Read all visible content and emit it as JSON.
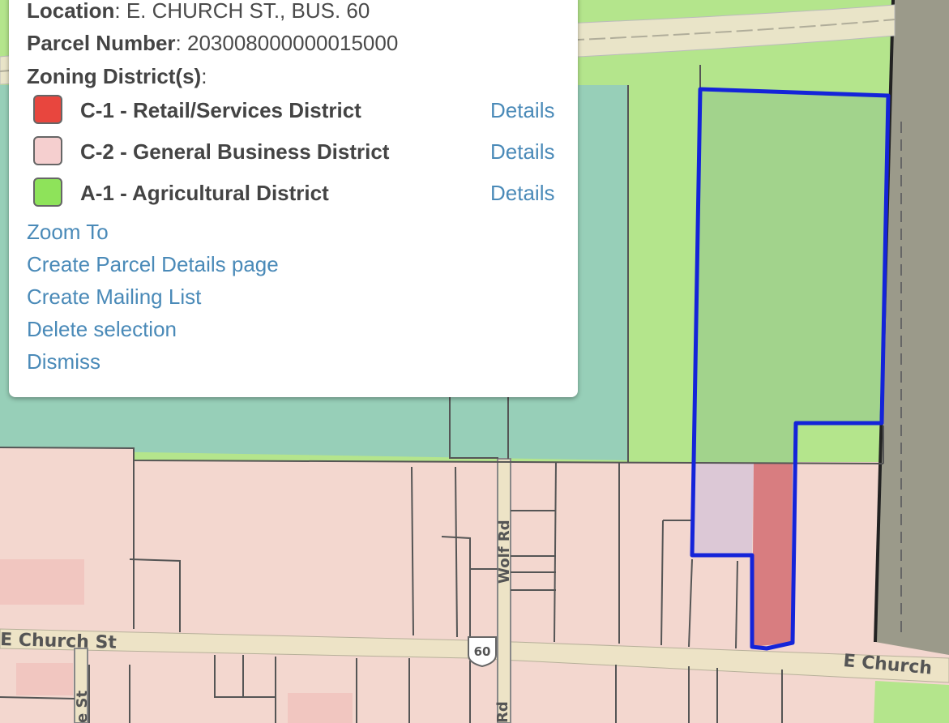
{
  "popup": {
    "location_label": "Location",
    "location_value": "E. CHURCH ST., BUS. 60",
    "parcel_label": "Parcel Number",
    "parcel_value": "203008000000015000",
    "zoning_label": "Zoning District(s)",
    "label_colon": ":",
    "zones": [
      {
        "label": "C-1 - Retail/Services District",
        "color": "#e8463e",
        "details": "Details"
      },
      {
        "label": "C-2 - General Business District",
        "color": "#f5cfcf",
        "details": "Details"
      },
      {
        "label": "A-1 - Agricultural District",
        "color": "#8ee35a",
        "details": "Details"
      }
    ],
    "actions": [
      "Zoom To",
      "Create Parcel Details page",
      "Create Mailing List",
      "Delete selection",
      "Dismiss"
    ]
  },
  "map": {
    "street_labels": {
      "church_west": "E Church St",
      "church_east": "E Church",
      "wolf_rd": "Wolf Rd",
      "rd_bottom": "Rd",
      "st_bottom": "e St",
      "route_shield": "60"
    },
    "colors": {
      "commercial": "#f3d7cf",
      "agricultural": "#b4e58c",
      "teal_zone": "#97cfb8",
      "selection": "#1424d9",
      "road": "#ede3c6",
      "industrial": "#9b9a8a"
    }
  }
}
